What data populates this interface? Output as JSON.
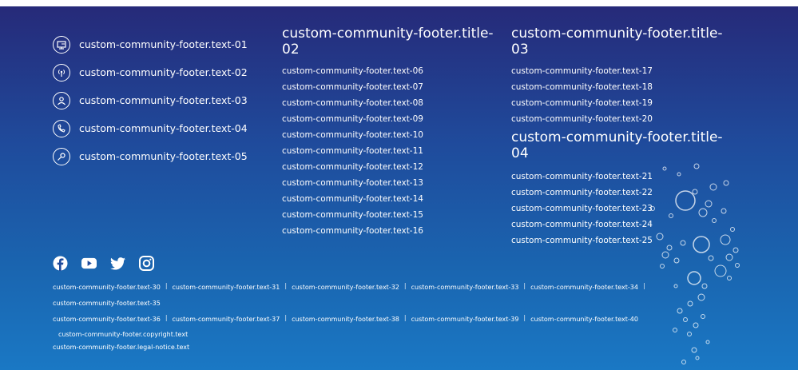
{
  "contact_links": [
    {
      "icon": "desktop-icon",
      "label": "custom-community-footer.text-01"
    },
    {
      "icon": "broadcast-icon",
      "label": "custom-community-footer.text-02"
    },
    {
      "icon": "user-icon",
      "label": "custom-community-footer.text-03"
    },
    {
      "icon": "phone-icon",
      "label": "custom-community-footer.text-04"
    },
    {
      "icon": "key-icon",
      "label": "custom-community-footer.text-05"
    }
  ],
  "column2": {
    "title": "custom-community-footer.title-02",
    "links": [
      "custom-community-footer.text-06",
      "custom-community-footer.text-07",
      "custom-community-footer.text-08",
      "custom-community-footer.text-09",
      "custom-community-footer.text-10",
      "custom-community-footer.text-11",
      "custom-community-footer.text-12",
      "custom-community-footer.text-13",
      "custom-community-footer.text-14",
      "custom-community-footer.text-15",
      "custom-community-footer.text-16"
    ]
  },
  "column3": {
    "title": "custom-community-footer.title-03",
    "links": [
      "custom-community-footer.text-17",
      "custom-community-footer.text-18",
      "custom-community-footer.text-19",
      "custom-community-footer.text-20"
    ]
  },
  "column4": {
    "title": "custom-community-footer.title-04",
    "links": [
      "custom-community-footer.text-21",
      "custom-community-footer.text-22",
      "custom-community-footer.text-23",
      "custom-community-footer.text-24",
      "custom-community-footer.text-25"
    ]
  },
  "social": [
    "facebook-icon",
    "youtube-icon",
    "twitter-icon",
    "instagram-icon"
  ],
  "bottom_links_row1": [
    "custom-community-footer.text-30",
    "custom-community-footer.text-31",
    "custom-community-footer.text-32",
    "custom-community-footer.text-33",
    "custom-community-footer.text-34"
  ],
  "bottom_links_row2": [
    "custom-community-footer.text-35"
  ],
  "bottom_links_row3": [
    "custom-community-footer.text-36",
    "custom-community-footer.text-37",
    "custom-community-footer.text-38",
    "custom-community-footer.text-39",
    "custom-community-footer.text-40"
  ],
  "copyright": "custom-community-footer.copyright.text",
  "legal_notice": "custom-community-footer.legal-notice.text",
  "colors": {
    "gradient_top": "#262a79",
    "gradient_bottom": "#1a78c4",
    "text": "#ffffff"
  }
}
